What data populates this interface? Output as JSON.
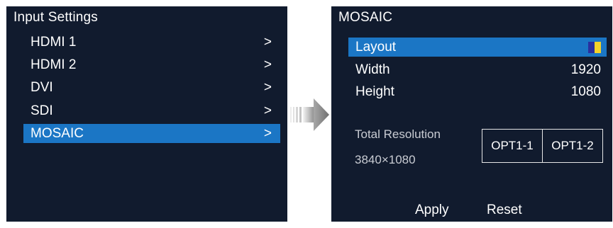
{
  "input_settings": {
    "title": "Input Settings",
    "items": [
      {
        "label": "HDMI 1",
        "arrow": ">",
        "selected": false
      },
      {
        "label": "HDMI 2",
        "arrow": ">",
        "selected": false
      },
      {
        "label": "DVI",
        "arrow": ">",
        "selected": false
      },
      {
        "label": "SDI",
        "arrow": ">",
        "selected": false
      },
      {
        "label": "MOSAIC",
        "arrow": ">",
        "selected": true
      }
    ]
  },
  "navigation_arrow": {
    "icon": "right-arrow-icon"
  },
  "mosaic": {
    "title": "MOSAIC",
    "layout": {
      "label": "Layout",
      "icon": "layout-split-icon",
      "icon_colors": [
        "#2a2f9e",
        "#f4d22a"
      ],
      "selected": true
    },
    "width": {
      "label": "Width",
      "value": "1920"
    },
    "height": {
      "label": "Height",
      "value": "1080"
    },
    "total_resolution": {
      "label": "Total Resolution",
      "value": "3840×1080"
    },
    "outputs": [
      "OPT1-1",
      "OPT1-2"
    ],
    "apply_label": "Apply",
    "reset_label": "Reset"
  },
  "colors": {
    "screen_bg": "#111b2e",
    "selection": "#1b76c5",
    "text": "#ffffff",
    "muted_text": "#c9ccd3"
  }
}
